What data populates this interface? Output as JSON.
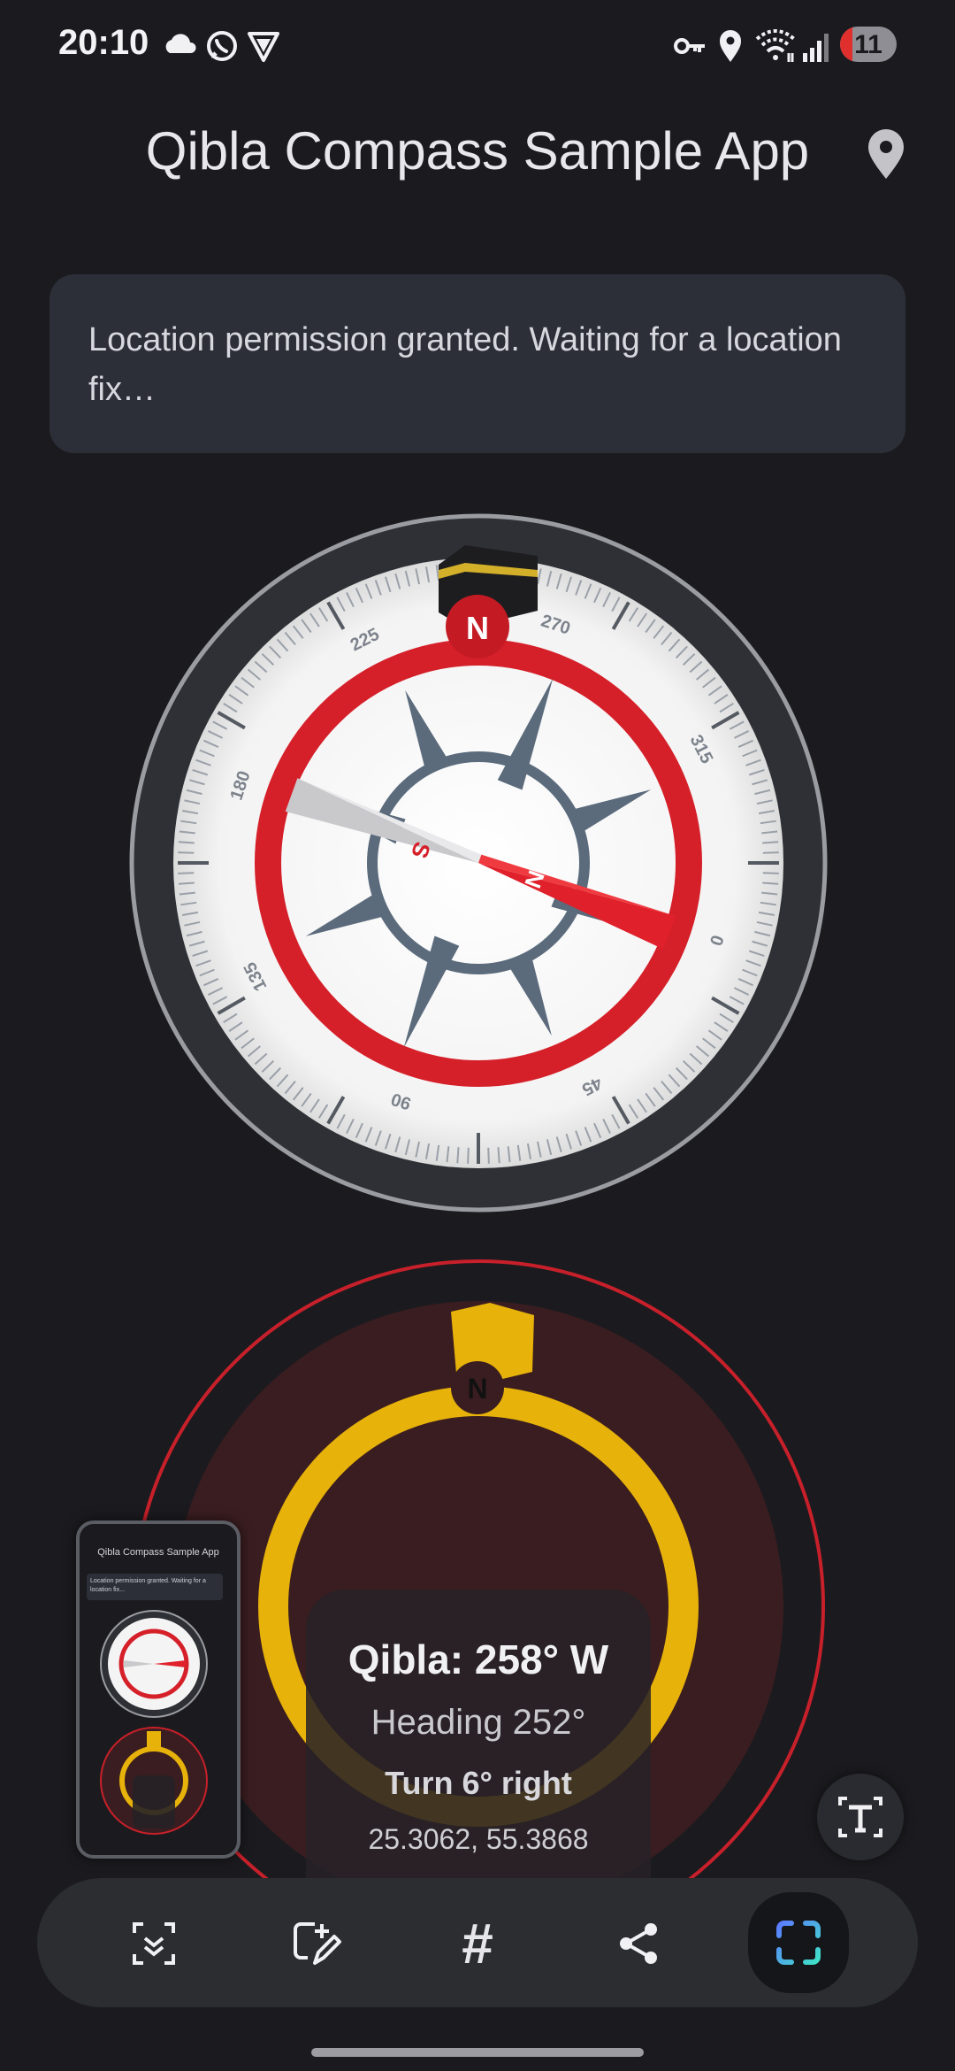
{
  "status_bar": {
    "time": "20:10",
    "left_icons": [
      "cloud-icon",
      "whatsapp-icon",
      "vpn-shield-icon"
    ],
    "right_icons": [
      "key-icon",
      "location-icon",
      "wifi-icon",
      "signal-icon"
    ],
    "battery": "11",
    "battery_color": "#e0302e"
  },
  "app_bar": {
    "title": "Qibla Compass Sample App",
    "action_icon": "location-pin-icon"
  },
  "info": {
    "message": "Location permission granted. Waiting for a location fix…"
  },
  "compass": {
    "north_marker": "N",
    "dial_labels": [
      "270",
      "315",
      "0",
      "45",
      "90",
      "135",
      "180",
      "225"
    ],
    "needle_north": "N",
    "needle_south": "S",
    "accent_color": "#e0202a"
  },
  "qibla": {
    "north_marker": "N",
    "qibla": "Qibla: 258° W",
    "heading": "Heading 252°",
    "turn": "Turn 6° right",
    "coordinates": "25.3062, 55.3868",
    "ring_color": "#e7b20a"
  },
  "thumbnail": {
    "title": "Qibla Compass Sample App",
    "message": "Location permission granted. Waiting for a location fix..."
  },
  "toolbar": {
    "items": [
      "scroll-capture-icon",
      "edit-icon",
      "hashtag-icon",
      "share-icon",
      "capture-icon"
    ],
    "hash_label": "#"
  }
}
